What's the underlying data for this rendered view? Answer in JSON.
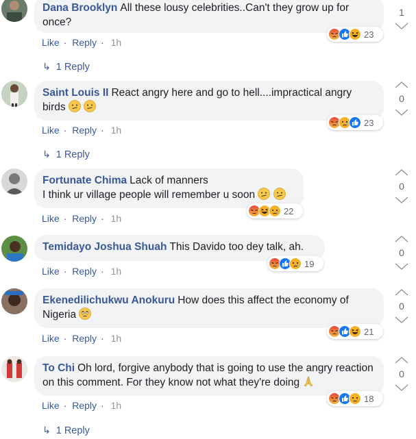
{
  "ui": {
    "like": "Like",
    "reply": "Reply"
  },
  "comments": [
    {
      "author": "Dana Brooklyn",
      "text": "All these lousy celebrities..Can't they grow up for once?",
      "time": "1h",
      "reaction_count": "23",
      "replies": "1 Reply",
      "score": "1",
      "reactions": [
        "angry",
        "like",
        "laugh"
      ]
    },
    {
      "author": "Saint Louis II",
      "text": "React angry here and go to hell....impractical angry birds",
      "time": "1h",
      "reaction_count": "23",
      "replies": "1 Reply",
      "score": "0",
      "reactions": [
        "angry",
        "sad",
        "like"
      ]
    },
    {
      "author": "Fortunate Chima",
      "text": "Lack of manners",
      "text2": "I think ur village people will remember u soon",
      "time": "1h",
      "reaction_count": "22",
      "score": "0",
      "reactions": [
        "angry",
        "laugh",
        "sad"
      ]
    },
    {
      "author": "Temidayo Joshua Shuah",
      "text": "This Davido too dey talk, ah.",
      "time": "1h",
      "reaction_count": "19",
      "score": "0",
      "reactions": [
        "angry",
        "like",
        "sad"
      ]
    },
    {
      "author": "Ekenedilichukwu Anokuru",
      "text": "How does this affect the economy of Nigeria",
      "time": "1h",
      "reaction_count": "21",
      "score": "0",
      "reactions": [
        "angry",
        "like",
        "laugh"
      ]
    },
    {
      "author": "To Chi",
      "text": "Oh lord, forgive anybody that is going to use the angry reaction on this comment. For they know not what they're doing",
      "time": "1h",
      "reaction_count": "18",
      "replies": "1 Reply",
      "score": "0",
      "reactions": [
        "angry",
        "like",
        "sad"
      ]
    }
  ],
  "colors": {
    "link": "#385898",
    "bubble": "#f2f3f5",
    "angry": "#f0653f",
    "like": "#1877f2",
    "haha": "#f7b125"
  }
}
